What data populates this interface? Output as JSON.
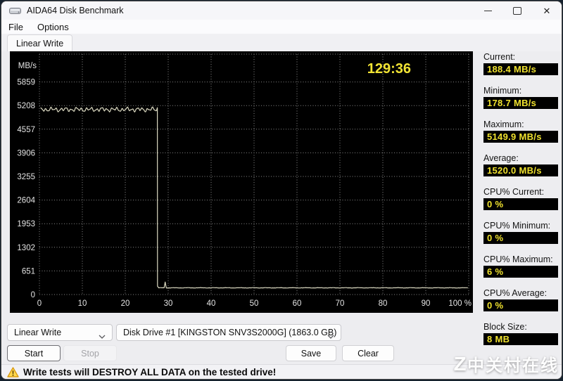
{
  "window": {
    "title": "AIDA64 Disk Benchmark"
  },
  "menu": {
    "file": "File",
    "options": "Options"
  },
  "tab": {
    "label": "Linear Write"
  },
  "chart_data": {
    "type": "line",
    "unit_label": "MB/s",
    "timer": "129:36",
    "y_ticks": [
      5859,
      5208,
      4557,
      3906,
      3255,
      2604,
      1953,
      1302,
      651,
      0
    ],
    "x_tick_labels": [
      "0",
      "10",
      "20",
      "30",
      "40",
      "50",
      "60",
      "70",
      "80",
      "90",
      "100 %"
    ],
    "ylim": [
      0,
      6510
    ],
    "xlim_pct": [
      0,
      100
    ],
    "grid": "dotted",
    "legend": "none",
    "series": [
      {
        "name": "Linear Write speed",
        "description": "Writes ~5100 MB/s (oscillating 4950-5250) from 0% to 27.5%, vertical drop at 27.5%, brief spike ~400 at 29.4%, then steady ~185 MB/s to 100%",
        "segments": [
          {
            "from_pct": 0.3,
            "to_pct": 27.4,
            "mean": 5100,
            "oscillation": 140
          },
          {
            "at_pct": 27.5,
            "drop_from": 5150,
            "drop_to": 230
          },
          {
            "spike_pct": 29.35,
            "spike_value": 400
          },
          {
            "from_pct": 27.8,
            "to_pct": 100,
            "mean": 185,
            "oscillation": 16
          }
        ]
      }
    ],
    "bg_color": "#000000",
    "line_color": "#dcdac2",
    "grid_color": "#8f8f8f",
    "tick_color": "#e4e4e4",
    "timer_color": "#f2e434"
  },
  "stats": {
    "sections": [
      {
        "label": "Current:",
        "value": "188.4 MB/s"
      },
      {
        "label": "Minimum:",
        "value": "178.7 MB/s"
      },
      {
        "label": "Maximum:",
        "value": "5149.9 MB/s"
      },
      {
        "label": "Average:",
        "value": "1520.0 MB/s"
      },
      {
        "label": "CPU% Current:",
        "value": "0 %"
      },
      {
        "label": "CPU% Minimum:",
        "value": "0 %"
      },
      {
        "label": "CPU% Maximum:",
        "value": "6 %"
      },
      {
        "label": "CPU% Average:",
        "value": "0 %"
      },
      {
        "label": "Block Size:",
        "value": "8 MB"
      }
    ]
  },
  "controls": {
    "test_dropdown": {
      "value": "Linear Write"
    },
    "drive_dropdown": {
      "value": "Disk Drive #1  [KINGSTON SNV3S2000G]  (1863.0 GB)"
    },
    "start": "Start",
    "stop": "Stop",
    "save": "Save",
    "clear": "Clear"
  },
  "status_bar": {
    "message": "Write tests will DESTROY ALL DATA on the tested drive!"
  },
  "watermark": {
    "logo": "Z",
    "text": "中关村在线"
  }
}
